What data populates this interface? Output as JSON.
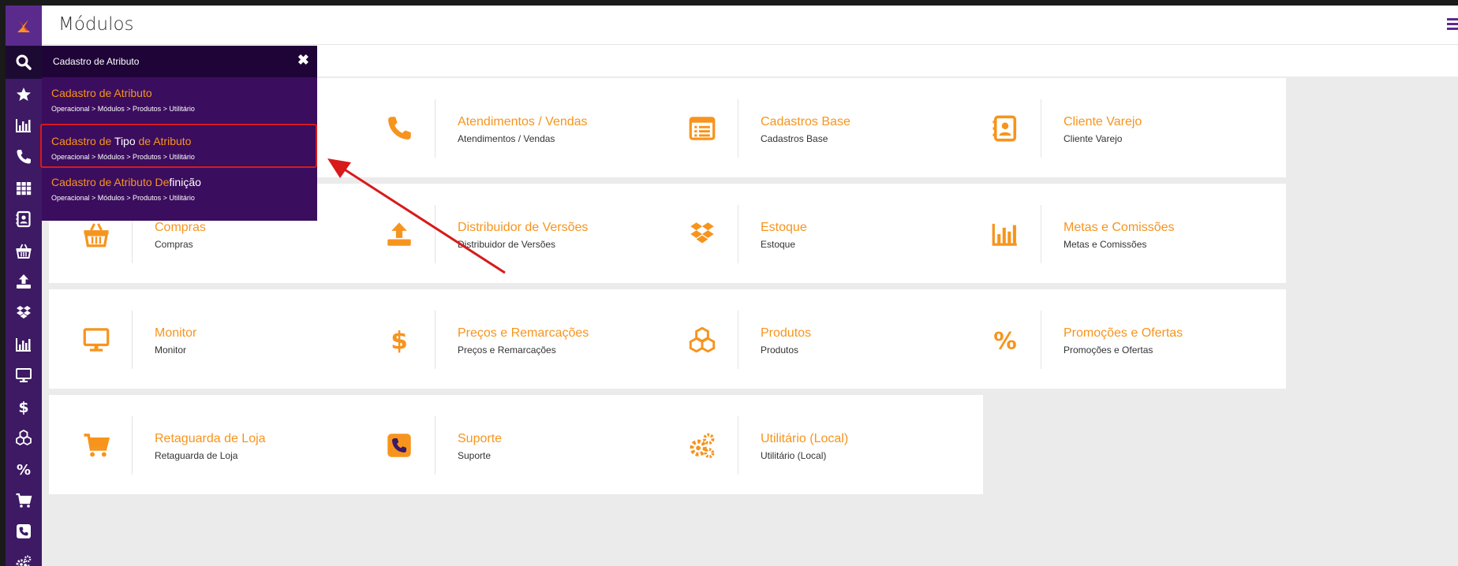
{
  "header": {
    "title": "Módulos"
  },
  "search": {
    "value": "Cadastro de Atributo",
    "results": [
      {
        "parts": [
          {
            "text": "Cadastro de Atributo",
            "hl": false
          }
        ],
        "path": "Operacional > Módulos > Produtos > Utilitário",
        "highlighted": false
      },
      {
        "parts": [
          {
            "text": "Cadastro de ",
            "hl": false
          },
          {
            "text": "Tipo",
            "hl": true
          },
          {
            "text": " de Atributo",
            "hl": false
          }
        ],
        "path": "Operacional > Módulos > Produtos > Utilitário",
        "highlighted": true
      },
      {
        "parts": [
          {
            "text": "Cadastro de Atributo De",
            "hl": false
          },
          {
            "text": "finição",
            "hl": true
          }
        ],
        "path": "Operacional > Módulos > Produtos > Utilitário",
        "highlighted": false
      }
    ]
  },
  "sidebar": {
    "items": [
      {
        "icon": "star-icon"
      },
      {
        "icon": "bar-chart-icon"
      },
      {
        "icon": "phone-icon"
      },
      {
        "icon": "grid-icon"
      },
      {
        "icon": "contact-book-icon"
      },
      {
        "icon": "basket-icon"
      },
      {
        "icon": "upload-icon"
      },
      {
        "icon": "dropbox-icon"
      },
      {
        "icon": "bar-chart-icon"
      },
      {
        "icon": "monitor-icon"
      },
      {
        "icon": "dollar-icon"
      },
      {
        "icon": "cubes-icon"
      },
      {
        "icon": "percent-icon"
      },
      {
        "icon": "cart-icon"
      },
      {
        "icon": "phone-square-icon"
      },
      {
        "icon": "cogs-icon"
      }
    ]
  },
  "modules": [
    {
      "title": "",
      "subtitle": "",
      "icon": ""
    },
    {
      "title": "Atendimentos / Vendas",
      "subtitle": "Atendimentos / Vendas",
      "icon": "phone-icon"
    },
    {
      "title": "Cadastros Base",
      "subtitle": "Cadastros Base",
      "icon": "list-icon"
    },
    {
      "title": "Cliente Varejo",
      "subtitle": "Cliente Varejo",
      "icon": "contact-book-icon"
    },
    {
      "title": "Compras",
      "subtitle": "Compras",
      "icon": "basket-icon"
    },
    {
      "title": "Distribuidor de Versões",
      "subtitle": "Distribuidor de Versões",
      "icon": "upload-icon"
    },
    {
      "title": "Estoque",
      "subtitle": "Estoque",
      "icon": "dropbox-icon"
    },
    {
      "title": "Metas e Comissões",
      "subtitle": "Metas e Comissões",
      "icon": "bar-chart-icon"
    },
    {
      "title": "Monitor",
      "subtitle": "Monitor",
      "icon": "monitor-icon"
    },
    {
      "title": "Preços e Remarcações",
      "subtitle": "Preços e Remarcações",
      "icon": "dollar-icon"
    },
    {
      "title": "Produtos",
      "subtitle": "Produtos",
      "icon": "cubes-icon"
    },
    {
      "title": "Promoções e Ofertas",
      "subtitle": "Promoções e Ofertas",
      "icon": "percent-icon"
    },
    {
      "title": "Retaguarda de Loja",
      "subtitle": "Retaguarda de Loja",
      "icon": "cart-icon"
    },
    {
      "title": "Suporte",
      "subtitle": "Suporte",
      "icon": "phone-square-icon"
    },
    {
      "title": "Utilitário (Local)",
      "subtitle": "Utilitário (Local)",
      "icon": "cogs-icon"
    }
  ],
  "colors": {
    "accent": "#f7941d",
    "sidebar": "#3d1a63",
    "dropdown": "#3b0d5e",
    "annotation": "#d81a1a"
  }
}
